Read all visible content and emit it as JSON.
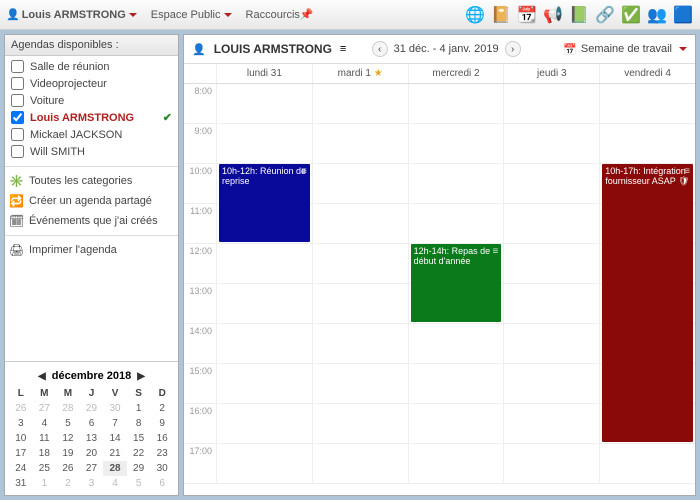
{
  "topbar": {
    "user": "Louis ARMSTRONG",
    "space": "Espace Public",
    "shortcuts": "Raccourcis"
  },
  "sidebar": {
    "title": "Agendas disponibles :",
    "cals": [
      {
        "label": "Salle de réunion",
        "checked": false
      },
      {
        "label": "Videoprojecteur",
        "checked": false
      },
      {
        "label": "Voiture",
        "checked": false
      },
      {
        "label": "Louis ARMSTRONG",
        "checked": true,
        "sel": true
      },
      {
        "label": "Mickael JACKSON",
        "checked": false
      },
      {
        "label": "Will SMITH",
        "checked": false
      }
    ],
    "actions": {
      "all_cat": "Toutes les categories",
      "shared": "Créer un agenda partagé",
      "my_events": "Événements que j'ai créés",
      "print": "Imprimer l'agenda"
    },
    "minical": {
      "month": "décembre 2018",
      "dow": [
        "L",
        "M",
        "M",
        "J",
        "V",
        "S",
        "D"
      ],
      "weeks": [
        [
          {
            "d": 26,
            "dim": 1
          },
          {
            "d": 27,
            "dim": 1
          },
          {
            "d": 28,
            "dim": 1
          },
          {
            "d": 29,
            "dim": 1
          },
          {
            "d": 30,
            "dim": 1
          },
          {
            "d": 1
          },
          {
            "d": 2
          }
        ],
        [
          {
            "d": 3
          },
          {
            "d": 4
          },
          {
            "d": 5
          },
          {
            "d": 6
          },
          {
            "d": 7
          },
          {
            "d": 8
          },
          {
            "d": 9
          }
        ],
        [
          {
            "d": 10
          },
          {
            "d": 11
          },
          {
            "d": 12
          },
          {
            "d": 13
          },
          {
            "d": 14
          },
          {
            "d": 15
          },
          {
            "d": 16
          }
        ],
        [
          {
            "d": 17
          },
          {
            "d": 18
          },
          {
            "d": 19
          },
          {
            "d": 20
          },
          {
            "d": 21
          },
          {
            "d": 22
          },
          {
            "d": 23
          }
        ],
        [
          {
            "d": 24
          },
          {
            "d": 25
          },
          {
            "d": 26
          },
          {
            "d": 27
          },
          {
            "d": 28,
            "today": 1
          },
          {
            "d": 29
          },
          {
            "d": 30
          }
        ],
        [
          {
            "d": 31
          },
          {
            "d": 1,
            "dim": 1
          },
          {
            "d": 2,
            "dim": 1
          },
          {
            "d": 3,
            "dim": 1
          },
          {
            "d": 4,
            "dim": 1
          },
          {
            "d": 5,
            "dim": 1
          },
          {
            "d": 6,
            "dim": 1
          }
        ]
      ]
    }
  },
  "main": {
    "user": "LOUIS ARMSTRONG",
    "range": "31 déc. - 4 janv. 2019",
    "view": "Semaine de travail",
    "days": [
      {
        "label": "lundi 31"
      },
      {
        "label": "mardi 1",
        "star": true
      },
      {
        "label": "mercredi 2"
      },
      {
        "label": "jeudi 3"
      },
      {
        "label": "vendredi 4"
      }
    ],
    "hours": [
      "8:00",
      "9:00",
      "10:00",
      "11:00",
      "12:00",
      "13:00",
      "14:00",
      "15:00",
      "16:00",
      "17:00"
    ],
    "events": [
      {
        "day": 0,
        "start": 2,
        "span": 2,
        "cls": "ev-blue",
        "text": "10h-12h: Réunion de reprise"
      },
      {
        "day": 2,
        "start": 4,
        "span": 2,
        "cls": "ev-green",
        "text": "12h-14h: Repas de début d'année"
      },
      {
        "day": 4,
        "start": 2,
        "span": 7,
        "cls": "ev-red",
        "text": "10h-17h: Intégration fournisseur ASAP 🛡"
      }
    ]
  }
}
